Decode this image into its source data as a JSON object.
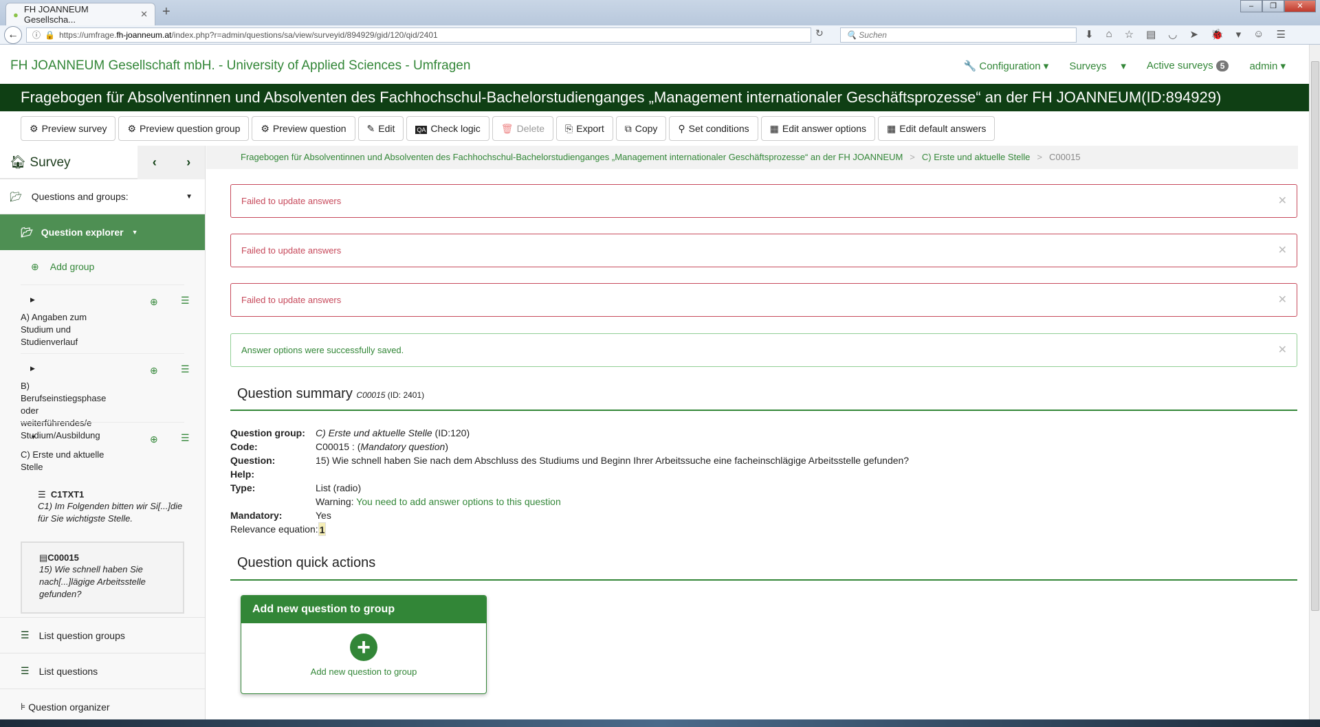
{
  "browser": {
    "tab_title": "FH JOANNEUM Gesellscha...",
    "url_prefix": "https://umfrage.",
    "url_host": "fh-joanneum.at",
    "url_path": "/index.php?r=admin/questions/sa/view/surveyid/894929/gid/120/qid/2401",
    "search_placeholder": "Suchen"
  },
  "topnav": {
    "brand": "FH JOANNEUM Gesellschaft mbH. - University of Applied Sciences - Umfragen",
    "configuration": "Configuration",
    "surveys": "Surveys",
    "active_surveys": "Active surveys",
    "active_count": "5",
    "admin": "admin"
  },
  "banner": "Fragebogen für Absolventinnen und Absolventen des Fachhochschul-Bachelorstudienganges „Management internationaler Geschäftsprozesse“ an der FH JOANNEUM(ID:894929)",
  "toolbar": [
    "Preview survey",
    "Preview question group",
    "Preview question",
    "Edit",
    "Check logic",
    "Delete",
    "Export",
    "Copy",
    "Set conditions",
    "Edit answer options",
    "Edit default answers"
  ],
  "sidebar": {
    "title": "Survey",
    "questions_groups": "Questions and groups:",
    "explorer": "Question explorer",
    "add_group": "Add group",
    "groups": [
      "A) Angaben zum Studium und Studienverlauf",
      "B) Berufseinstiegsphase oder weiterführendes/e Studium/Ausbildung",
      "C) Erste und aktuelle Stelle"
    ],
    "questions": [
      {
        "code": "C1TXT1",
        "text": "C1) Im Folgenden bitten wir Si[...]die für Sie wichtigste Stelle."
      },
      {
        "code": "C00015",
        "text": "15) Wie schnell haben Sie nach[...]lägige Arbeitsstelle gefunden?"
      }
    ],
    "list_groups": "List question groups",
    "list_questions": "List questions",
    "organizer": "Question organizer"
  },
  "breadcrumb": [
    "Fragebogen für Absolventinnen und Absolventen des Fachhochschul-Bachelorstudienganges „Management internationaler Geschäftsprozesse“ an der FH JOANNEUM",
    "C) Erste und aktuelle Stelle",
    "C00015"
  ],
  "alerts": [
    "Failed to update answers",
    "Failed to update answers",
    "Failed to update answers",
    "Answer options were successfully saved."
  ],
  "summary": {
    "heading": "Question summary",
    "code": "C00015",
    "id": "(ID: 2401)",
    "group_label": "Question group:",
    "group_value": "C) Erste und aktuelle Stelle",
    "group_id": "(ID:120)",
    "code_label": "Code:",
    "code_value": "C00015 : (",
    "mandatory_q": "Mandatory question",
    "close_paren": ")",
    "question_label": "Question:",
    "question_value": "15) Wie schnell haben Sie nach dem Abschluss des Studiums und Beginn Ihrer Arbeitssuche eine facheinschlägige Arbeitsstelle gefunden?",
    "help_label": "Help:",
    "type_label": "Type:",
    "type_value": "List (radio)",
    "warning_label": "Warning:",
    "warning_value": "You need to add answer options to this question",
    "mandatory_label": "Mandatory:",
    "mandatory_value": "Yes",
    "relevance_label": "Relevance equation:",
    "relevance_value": "1"
  },
  "quick": {
    "heading": "Question quick actions",
    "card_title": "Add new question to group",
    "card_label": "Add new question to group"
  },
  "colors": {
    "brand": "#328637",
    "banner": "#0f3f14",
    "error": "#c6485a"
  }
}
